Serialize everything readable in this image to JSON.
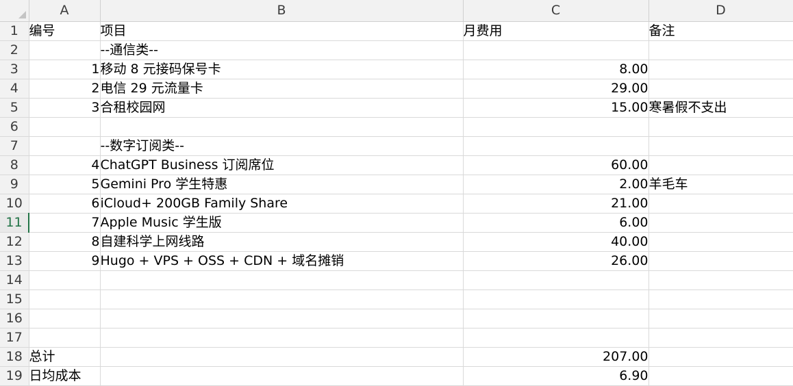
{
  "columns": [
    "A",
    "B",
    "C",
    "D"
  ],
  "active_row": "11",
  "rows": [
    {
      "row": "1",
      "a": "编号",
      "a_align": "left",
      "b": "项目",
      "c": "月费用",
      "c_align": "left",
      "d": "备注"
    },
    {
      "row": "2",
      "a": "",
      "b": "--通信类--",
      "c": "",
      "d": ""
    },
    {
      "row": "3",
      "a": "1",
      "b": "移动 8 元接码保号卡",
      "c": "8.00",
      "d": ""
    },
    {
      "row": "4",
      "a": "2",
      "b": "电信 29 元流量卡",
      "c": "29.00",
      "d": ""
    },
    {
      "row": "5",
      "a": "3",
      "b": "合租校园网",
      "c": "15.00",
      "d": "寒暑假不支出"
    },
    {
      "row": "6",
      "a": "",
      "b": "",
      "c": "",
      "d": ""
    },
    {
      "row": "7",
      "a": "",
      "b": "--数字订阅类--",
      "c": "",
      "d": ""
    },
    {
      "row": "8",
      "a": "4",
      "b": "ChatGPT Business 订阅席位",
      "c": "60.00",
      "d": ""
    },
    {
      "row": "9",
      "a": "5",
      "b": "Gemini Pro 学生特惠",
      "c": "2.00",
      "d": "羊毛车"
    },
    {
      "row": "10",
      "a": "6",
      "b": "iCloud+ 200GB Family Share",
      "c": "21.00",
      "d": ""
    },
    {
      "row": "11",
      "a": "7",
      "b": "Apple Music 学生版",
      "c": "6.00",
      "d": ""
    },
    {
      "row": "12",
      "a": "8",
      "b": "自建科学上网线路",
      "c": "40.00",
      "d": ""
    },
    {
      "row": "13",
      "a": "9",
      "b": "Hugo + VPS + OSS + CDN + 域名摊销",
      "c": "26.00",
      "d": ""
    },
    {
      "row": "14",
      "a": "",
      "b": "",
      "c": "",
      "d": ""
    },
    {
      "row": "15",
      "a": "",
      "b": "",
      "c": "",
      "d": ""
    },
    {
      "row": "16",
      "a": "",
      "b": "",
      "c": "",
      "d": ""
    },
    {
      "row": "17",
      "a": "",
      "b": "",
      "c": "",
      "d": ""
    },
    {
      "row": "18",
      "a": "总计",
      "a_align": "left",
      "b": "",
      "c": "207.00",
      "d": ""
    },
    {
      "row": "19",
      "a": "日均成本",
      "a_align": "left",
      "b": "",
      "c": "6.90",
      "d": ""
    }
  ]
}
